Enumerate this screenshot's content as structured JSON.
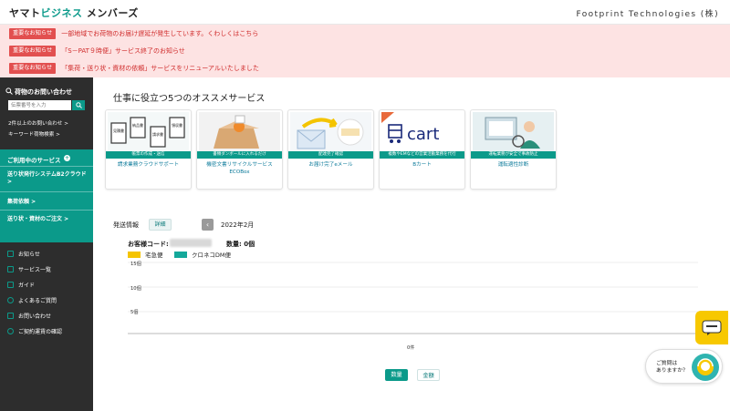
{
  "header": {
    "logo_prefix": "ヤマト",
    "logo_accent": "ビジネス",
    "logo_suffix": " メンバーズ",
    "company": "Footprint Technologies (株)"
  },
  "alerts": [
    {
      "tag": "重要なお知らせ",
      "message": "一部地域でお荷物のお届け遅延が発生しています。くわしくはこちら"
    },
    {
      "tag": "重要なお知らせ",
      "message": "「S－PAT９時便」サービス終了のお知らせ"
    },
    {
      "tag": "重要なお知らせ",
      "message": "「集荷・送り状・資材の依頼」サービスをリニューアルいたしました"
    }
  ],
  "sidebar": {
    "track_title": "荷物のお問い合わせ",
    "search_placeholder": "伝票番号を入力",
    "links": [
      "2件以上のお問い合わせ >",
      "キーワード荷物検索 >"
    ],
    "services_heading": "ご利用中のサービス",
    "services": [
      "送り状発行システムB2クラウド >",
      "集荷依頼 >",
      "送り状・資材のご注文 >"
    ],
    "nav": [
      {
        "label": "お知らせ",
        "icon": "envelope-icon"
      },
      {
        "label": "サービス一覧",
        "icon": "list-icon"
      },
      {
        "label": "ガイド",
        "icon": "book-icon"
      },
      {
        "label": "よくあるご質問",
        "icon": "question-icon"
      },
      {
        "label": "お問い合わせ",
        "icon": "mail-icon"
      },
      {
        "label": "ご契約運賃の確認",
        "icon": "yen-icon"
      }
    ]
  },
  "main": {
    "section_title": "仕事に役立つ5つのオススメサービス",
    "cards": [
      {
        "band": "帳票の作成・送信",
        "name": "請求業務クラウドサポート",
        "img_labels": [
          "見積書",
          "納品書",
          "請求書",
          "領収書"
        ]
      },
      {
        "band": "書類ダンボールに入れるだけ",
        "name": "機密文書リサイクルサービス ECOBox"
      },
      {
        "band": "配達完了確認",
        "name": "お届け完了eメール"
      },
      {
        "band": "複数やEMなどの営業活動業務を代行",
        "name": "Bカート",
        "img_text": "cart"
      },
      {
        "band": "運転業務が安全で事故防止",
        "name": "運転適性診断"
      }
    ],
    "shipment": {
      "title": "発送情報",
      "detail_button": "詳細",
      "prev_icon": "chevron-left-icon",
      "month": "2022年2月",
      "customer_code_label": "お客様コード:",
      "count_label": "数量: 0個",
      "toggle_quantity": "数量",
      "toggle_amount": "金額"
    }
  },
  "chart_data": {
    "type": "bar",
    "categories": [
      ""
    ],
    "series": [
      {
        "name": "宅急便",
        "values": [
          0
        ],
        "color": "#f5c400"
      },
      {
        "name": "クロネコDM便",
        "values": [
          0
        ],
        "color": "#14a89a"
      }
    ],
    "y_ticks": [
      "15個",
      "10個",
      "5個"
    ],
    "x_total_label": "0件",
    "ylim": [
      0,
      15
    ],
    "grid": true,
    "legend_position": "top-left"
  },
  "widgets": {
    "chat_icon": "line-chat-icon",
    "help_text_1": "ご質問は",
    "help_text_2": "ありますか？"
  },
  "colors": {
    "accent": "#0b9a8a",
    "alert_bg": "#fde3e3",
    "alert_red": "#e24f4f",
    "sidebar_bg": "#2d2d2d"
  }
}
